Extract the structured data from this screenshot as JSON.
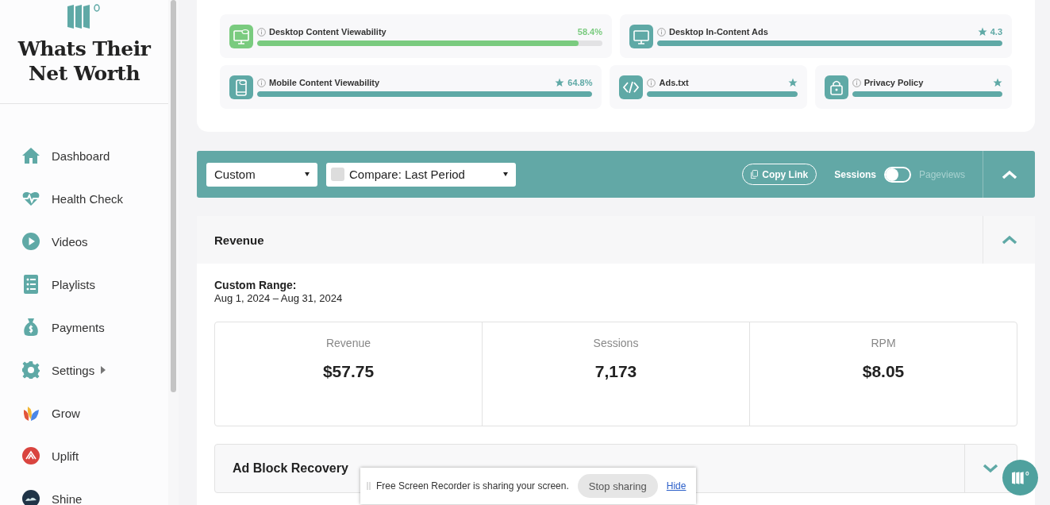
{
  "sidebar": {
    "brand": "Whats Their Net Worth",
    "items": [
      {
        "label": "Dashboard",
        "kind": "home",
        "submenu": false
      },
      {
        "label": "Health Check",
        "kind": "heart",
        "submenu": false
      },
      {
        "label": "Videos",
        "kind": "play",
        "submenu": false
      },
      {
        "label": "Playlists",
        "kind": "list",
        "submenu": false
      },
      {
        "label": "Payments",
        "kind": "money",
        "submenu": false
      },
      {
        "label": "Settings",
        "kind": "gear",
        "submenu": true
      },
      {
        "label": "Grow",
        "kind": "grow",
        "submenu": false
      },
      {
        "label": "Uplift",
        "kind": "uplift",
        "submenu": false
      },
      {
        "label": "Shine",
        "kind": "shine",
        "submenu": false
      }
    ]
  },
  "health_rows": [
    [
      {
        "kind": "desktop-eye",
        "title": "Desktop Content Viewability",
        "value": "58.4%",
        "star": false,
        "level": 0.93,
        "color": "#7acb7f"
      },
      {
        "kind": "desktop",
        "title": "Desktop In-Content Ads",
        "value": "4.3",
        "star": true,
        "level": 1,
        "color": "#5fa9a6"
      }
    ],
    [
      {
        "kind": "mobile-eye",
        "title": "Mobile Content Viewability",
        "value": "64.8%",
        "star": true,
        "level": 1,
        "color": "#5fa9a6"
      },
      {
        "kind": "code",
        "title": "Ads.txt",
        "star": true,
        "level": 1,
        "color": "#5fa9a6"
      },
      {
        "kind": "lock",
        "title": "Privacy Policy",
        "star": true,
        "level": 1,
        "color": "#5fa9a6"
      }
    ]
  ],
  "filter_bar": {
    "range": "Custom",
    "compare": "Compare: Last Period",
    "copy_link": "Copy Link",
    "toggle_left": "Sessions",
    "toggle_right": "Pageviews",
    "toggle_on": false
  },
  "revenue": {
    "title": "Revenue",
    "range_label": "Custom Range:",
    "range_dates": "Aug 1, 2024 – Aug 31, 2024",
    "stats": [
      {
        "label": "Revenue",
        "value": "$57.75"
      },
      {
        "label": "Sessions",
        "value": "7,173"
      },
      {
        "label": "RPM",
        "value": "$8.05"
      }
    ]
  },
  "ad_block": {
    "title": "Ad Block Recovery"
  },
  "share_bar": {
    "message": "Free Screen Recorder is sharing your screen.",
    "stop": "Stop sharing",
    "hide": "Hide"
  }
}
